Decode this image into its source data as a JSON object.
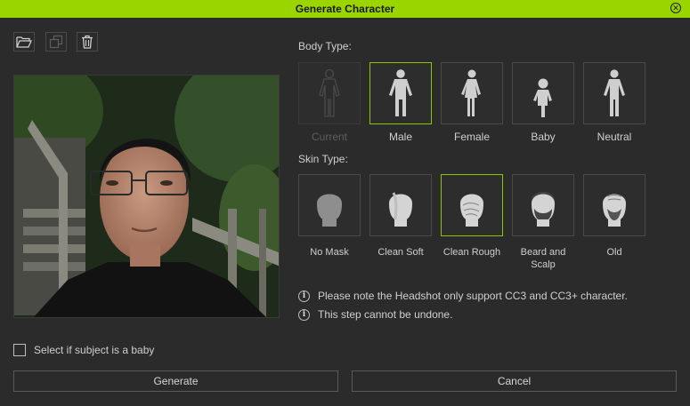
{
  "window": {
    "title": "Generate Character"
  },
  "toolbar": {
    "open_icon": "folder-open-icon",
    "copy_icon": "copy-icon",
    "delete_icon": "trash-icon"
  },
  "body_type": {
    "label": "Body Type:",
    "options": [
      {
        "label": "Current",
        "state": "disabled"
      },
      {
        "label": "Male",
        "state": "selected"
      },
      {
        "label": "Female",
        "state": "normal"
      },
      {
        "label": "Baby",
        "state": "normal"
      },
      {
        "label": "Neutral",
        "state": "normal"
      }
    ]
  },
  "skin_type": {
    "label": "Skin Type:",
    "options": [
      {
        "label": "No Mask",
        "state": "normal"
      },
      {
        "label": "Clean Soft",
        "state": "normal"
      },
      {
        "label": "Clean Rough",
        "state": "selected"
      },
      {
        "label": "Beard and Scalp",
        "state": "normal"
      },
      {
        "label": "Old",
        "state": "normal"
      }
    ]
  },
  "notes": [
    "Please note the Headshot only support CC3 and CC3+ character.",
    "This step cannot be undone."
  ],
  "baby_checkbox": {
    "label": "Select if subject is a baby",
    "checked": false
  },
  "buttons": {
    "generate": "Generate",
    "cancel": "Cancel"
  },
  "colors": {
    "accent": "#9ad500",
    "selected_border": "#8ec400",
    "background": "#2b2b2b"
  }
}
